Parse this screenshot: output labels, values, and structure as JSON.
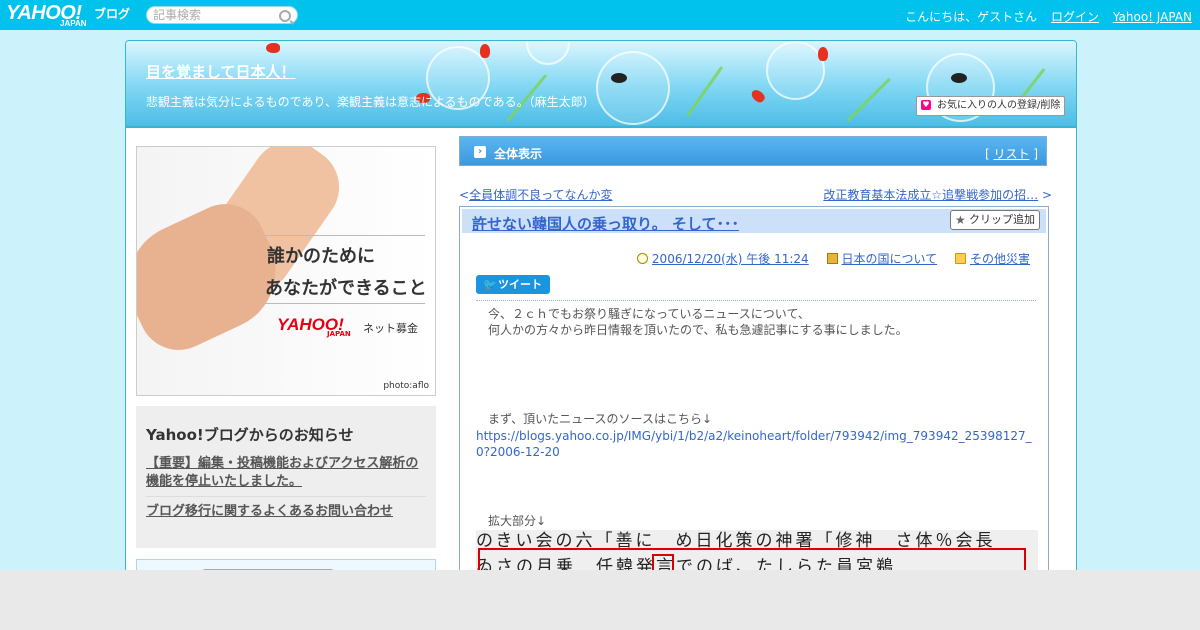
{
  "topbar": {
    "logo_text": "YAHOO!",
    "logo_blog": "ブログ",
    "logo_japan": "JAPAN",
    "search_placeholder": "記事検索",
    "greeting": "こんにちは、ゲストさん",
    "login": "ログイン",
    "yahoo_japan": "Yahoo! JAPAN"
  },
  "banner": {
    "title": "目を覚まして日本人！",
    "description": "悲観主義は気分によるものであり、楽観主義は意志によるものである。（麻生太郎）",
    "fav_button": "お気に入りの人の登録/削除"
  },
  "ad": {
    "line1": "誰かのために",
    "line2": "あなたができること",
    "logo": "YAHOO!",
    "logo_japan": "JAPAN",
    "net": "ネット募金",
    "photo": "photo:aflo"
  },
  "notice": {
    "heading": "Yahoo!ブログからのお知らせ",
    "items": [
      "【重要】編集・投稿機能およびアクセス解析の機能を停止いたしました。",
      "ブログ移行に関するよくあるお問い合わせ"
    ]
  },
  "main": {
    "all_title": "全体表示",
    "list_open": "[",
    "list_label": "リスト",
    "list_close": "]",
    "prev": "全員体調不良ってなんか変",
    "next": "改正教育基本法成立☆追撃戦参加の招…",
    "prev_arrow": "<",
    "next_arrow": ">"
  },
  "article": {
    "title": "許せない韓国人の乗っ取り。 そして･･･",
    "clip": "クリップ追加",
    "date": "2006/12/20(水) 午後 11:24",
    "category1": "日本の国について",
    "category2": "その他災害",
    "tweet": "ツイート",
    "para1": "今、２ｃｈでもお祭り騒ぎになっているニュースについて、",
    "para2": "何人かの方々から昨日情報を頂いたので、私も急遽記事にする事にしました。",
    "para3": "まず、頂いたニュースのソースはこちら↓",
    "image_link": "https://blogs.yahoo.co.jp/IMG/ybi/1/b2/a2/keinoheart/folder/793942/img_793942_25398127_0?2006-12-20",
    "para4": "拡大部分↓",
    "scan_line1": "のきい会の六「善に　め日化策の神署「修神　さ体％会長",
    "scan_line2": "ゐさの月乗　任韓発言でのば、たしらた員宮鵜"
  },
  "colors": {
    "topbar": "#00c2ec",
    "link": "#3366cc",
    "frame_border": "#3bb4d0",
    "all_bar": "#3b98e0"
  }
}
